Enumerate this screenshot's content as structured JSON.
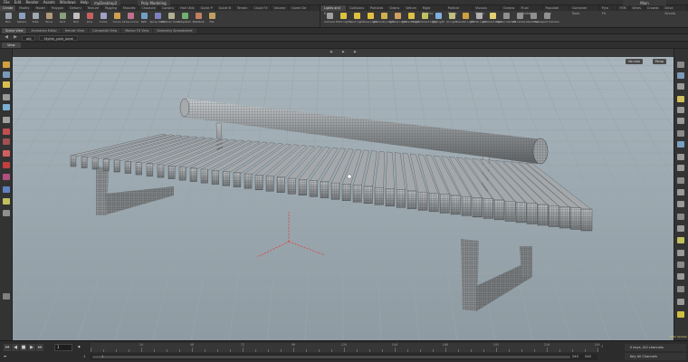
{
  "app": {
    "menu": [
      "File",
      "Edit",
      "Render",
      "Assets",
      "Windows",
      "Help"
    ],
    "desktop": "myDesktop2",
    "desktop_mode": "Poly Modeling",
    "main_label": "Main"
  },
  "shelf_left": {
    "tabs": [
      "Create",
      "Modify",
      "Model",
      "Polygon",
      "Deform",
      "Texture",
      "Rigging",
      "Muscles",
      "Characte",
      "Constru",
      "Hair Utils",
      "Guide P",
      "Guide B",
      "Terrain",
      "Cloud FX",
      "Volume",
      "Game De"
    ],
    "tools": [
      {
        "label": "Box",
        "color": "#9aa0a8"
      },
      {
        "label": "Sphere",
        "color": "#8aa2c0"
      },
      {
        "label": "Tube",
        "color": "#a0a8b0"
      },
      {
        "label": "Torus",
        "color": "#b09878"
      },
      {
        "label": "Grid",
        "color": "#8aa07a"
      },
      {
        "label": "Null",
        "color": "#c0c0c0"
      },
      {
        "label": "Line",
        "color": "#c86060"
      },
      {
        "label": "Circle",
        "color": "#a0a0c8"
      },
      {
        "label": "Curve",
        "color": "#d0a050"
      },
      {
        "label": "Draw Curve",
        "color": "#c07090"
      },
      {
        "label": "Path",
        "color": "#70a0c0"
      },
      {
        "label": "Spray Paint",
        "color": "#8080c0"
      },
      {
        "label": "Platonic Solids",
        "color": "#b0b090"
      },
      {
        "label": "L-System",
        "color": "#70b070"
      },
      {
        "label": "Metaball",
        "color": "#c08060"
      },
      {
        "label": "File",
        "color": "#c0a060"
      }
    ]
  },
  "shelf_right": {
    "tabs": [
      "Lights and C",
      "Collisions",
      "Particles",
      "Grains",
      "Vellum",
      "Rigid Bodies",
      "Particle Fluids",
      "Viscous Fluids",
      "Oceans",
      "Fluid Contai",
      "Populate Con",
      "Container Tools",
      "Pyro FX",
      "FEM",
      "Wires",
      "Crowds",
      "Drive Simula"
    ],
    "tools": [
      {
        "label": "Camera",
        "color": "#a0a0a0"
      },
      {
        "label": "Point Light",
        "color": "#e0c040"
      },
      {
        "label": "Spot Light",
        "color": "#e0c040"
      },
      {
        "label": "Area Light",
        "color": "#e0c040"
      },
      {
        "label": "Geometry Light",
        "color": "#d0b050"
      },
      {
        "label": "Volume Light",
        "color": "#d0a060"
      },
      {
        "label": "Distant Light",
        "color": "#e0c040"
      },
      {
        "label": "Environment Light",
        "color": "#c0c060"
      },
      {
        "label": "Sky Light",
        "color": "#80b0e0"
      },
      {
        "label": "GI Light",
        "color": "#c0c080"
      },
      {
        "label": "Caustic Light",
        "color": "#d0a040"
      },
      {
        "label": "Portal Light",
        "color": "#b0b0b0"
      },
      {
        "label": "Ambient Light",
        "color": "#e0d070"
      },
      {
        "label": "Stereo Camera",
        "color": "#909090"
      },
      {
        "label": "VR Camera",
        "color": "#909090"
      },
      {
        "label": "Switcher",
        "color": "#909090"
      },
      {
        "label": "Gamepad Camera",
        "color": "#909090"
      }
    ]
  },
  "pane_tabs": [
    "Scene View",
    "Animation Editor",
    "Render View",
    "Composite View",
    "Motion FX View",
    "Geometry Spreadsheet"
  ],
  "path": {
    "root": "obj",
    "node": "Stylish_park_bank"
  },
  "view_tab": "View",
  "viewport": {
    "camera_menu": "No cam",
    "persp_menu": "Persp"
  },
  "timeline": {
    "frame": "1",
    "ticks": [
      "24",
      "48",
      "72",
      "96",
      "120",
      "144",
      "168",
      "192",
      "216",
      "240"
    ],
    "start": "1",
    "start2": "1",
    "end": "240",
    "end2": "240",
    "keys_info": "0 keys, 0/0 channels",
    "channels_info": "Key All Channels",
    "auto_update": "Auto Update"
  }
}
